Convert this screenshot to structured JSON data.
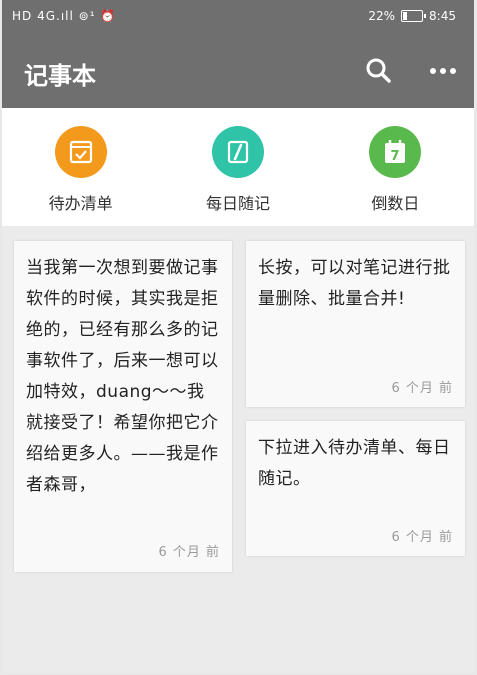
{
  "status_bar": {
    "left_text": "HD 4G.ıll ⊚¹ ⏰",
    "battery_percent": "22%",
    "time": "8:45",
    "battery_level": 0.22
  },
  "app_bar": {
    "title": "记事本",
    "icons": [
      "search-icon",
      "more-icon"
    ]
  },
  "quick_menu": [
    {
      "label": "待办清单",
      "color": "#f39a1d",
      "icon": "todo-checklist-icon"
    },
    {
      "label": "每日随记",
      "color": "#2fc3a7",
      "icon": "daily-note-icon"
    },
    {
      "label": "倒数日",
      "color": "#5ab94d",
      "icon": "calendar-countdown-icon",
      "day": "7"
    }
  ],
  "notes": [
    {
      "text": "当我第一次想到要做记事软件的时候，其实我是拒绝的，已经有那么多的记事软件了，后来一想可以加特效，duang～～我就接受了！希望你把它介绍给更多人。——我是作者森哥，",
      "time": "6 个月 前"
    },
    {
      "text": "长按，可以对笔记进行批量删除、批量合并!",
      "time": "6 个月 前"
    },
    {
      "text": "下拉进入待办清单、每日随记。",
      "time": "6 个月 前"
    }
  ]
}
